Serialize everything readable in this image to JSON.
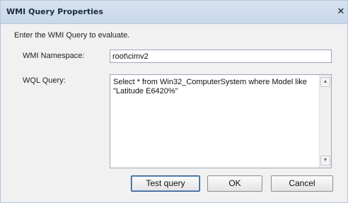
{
  "window": {
    "title": "WMI Query Properties",
    "close_glyph": "✕"
  },
  "form": {
    "instruction": "Enter the WMI Query to evaluate.",
    "namespace_label": "WMI Namespace:",
    "namespace_value": "root\\cimv2",
    "wql_label": "WQL Query:",
    "wql_value": "Select * from Win32_ComputerSystem where Model like \"Latitude E6420%\""
  },
  "buttons": {
    "test_query": "Test query",
    "ok": "OK",
    "cancel": "Cancel"
  },
  "scrollbar": {
    "up_glyph": "▲",
    "down_glyph": "▼"
  }
}
